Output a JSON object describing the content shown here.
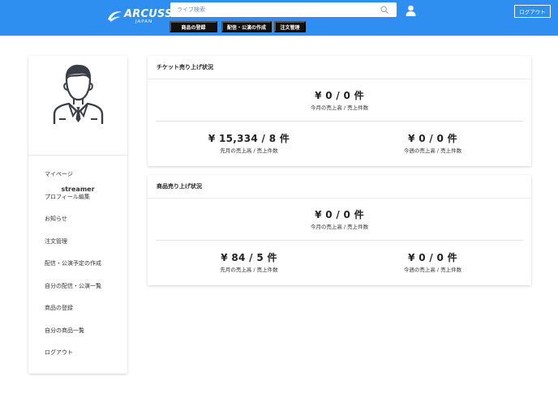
{
  "header": {
    "logo_text": "ARCUSS",
    "logo_sub": "JAPAN",
    "search_placeholder": "ライブ検索",
    "logout_label": "ログアウト",
    "nav": [
      "商品の登録",
      "配信・公演の作成",
      "注文管理"
    ]
  },
  "sidebar": {
    "username": "streamer",
    "items": [
      {
        "label": "マイページ"
      },
      {
        "label": "プロフィール編集"
      },
      {
        "label": "お知らせ"
      },
      {
        "label": "注文管理"
      },
      {
        "label": "配信・公演予定の作成"
      },
      {
        "label": "自分の配信・公演一覧"
      },
      {
        "label": "商品の登録"
      },
      {
        "label": "自分の商品一覧"
      },
      {
        "label": "ログアウト"
      }
    ]
  },
  "ticket_sales": {
    "title": "チケット売り上げ状況",
    "this_month": {
      "value": "¥ 0 / 0 件",
      "label": "今月の売上高 / 売上件数"
    },
    "last_month": {
      "value": "¥ 15,334 / 8 件",
      "label": "先月の売上高 / 売上件数"
    },
    "this_week": {
      "value": "¥ 0 / 0 件",
      "label": "今週の売上高 / 売上件数"
    }
  },
  "product_sales": {
    "title": "商品売り上げ状況",
    "this_month": {
      "value": "¥ 0 / 0 件",
      "label": "今月の売上高 / 売上件数"
    },
    "last_month": {
      "value": "¥ 84 / 5 件",
      "label": "先月の売上高 / 売上件数"
    },
    "this_week": {
      "value": "¥ 0 / 0 件",
      "label": "今週の売上高 / 売上件数"
    }
  },
  "colors": {
    "header_bg": "#2f8ff0",
    "nav_button_bg": "#111111"
  }
}
